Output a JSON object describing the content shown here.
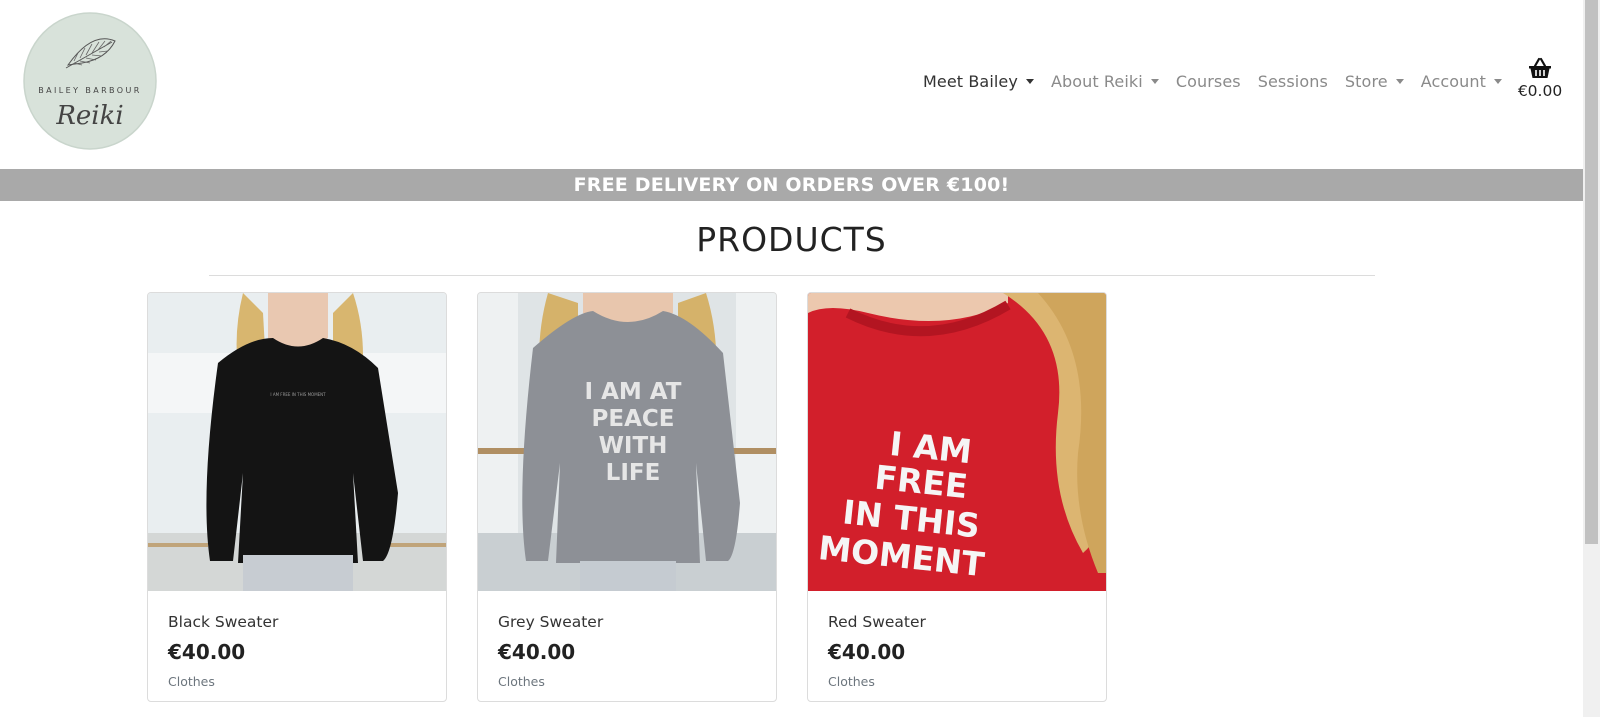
{
  "logo": {
    "line1": "BAILEY BARBOUR",
    "line2": "Reiki"
  },
  "nav": {
    "items": [
      {
        "label": "Meet Bailey",
        "dropdown": true,
        "active": true
      },
      {
        "label": "About Reiki",
        "dropdown": true,
        "active": false
      },
      {
        "label": "Courses",
        "dropdown": false,
        "active": false
      },
      {
        "label": "Sessions",
        "dropdown": false,
        "active": false
      },
      {
        "label": "Store",
        "dropdown": true,
        "active": false
      },
      {
        "label": "Account",
        "dropdown": true,
        "active": false
      }
    ],
    "basket_icon": "basket-icon",
    "basket_total": "€0.00"
  },
  "banner": {
    "text": "FREE DELIVERY ON ORDERS OVER €100!",
    "color": "#a9a9a9"
  },
  "page": {
    "title": "PRODUCTS"
  },
  "products": [
    {
      "name": "Black Sweater",
      "price": "€40.00",
      "category": "Clothes",
      "sweater_color": "#141414",
      "print": "I AM FREE IN THIS MOMENT"
    },
    {
      "name": "Grey Sweater",
      "price": "€40.00",
      "category": "Clothes",
      "sweater_color": "#8d9096",
      "print_lines": [
        "I AM AT",
        "PEACE",
        "WITH",
        "LIFE"
      ]
    },
    {
      "name": "Red Sweater",
      "price": "€40.00",
      "category": "Clothes",
      "sweater_color": "#d21f2b",
      "print_lines": [
        "I AM",
        "FREE",
        "IN THIS",
        "MOMENT"
      ]
    }
  ]
}
